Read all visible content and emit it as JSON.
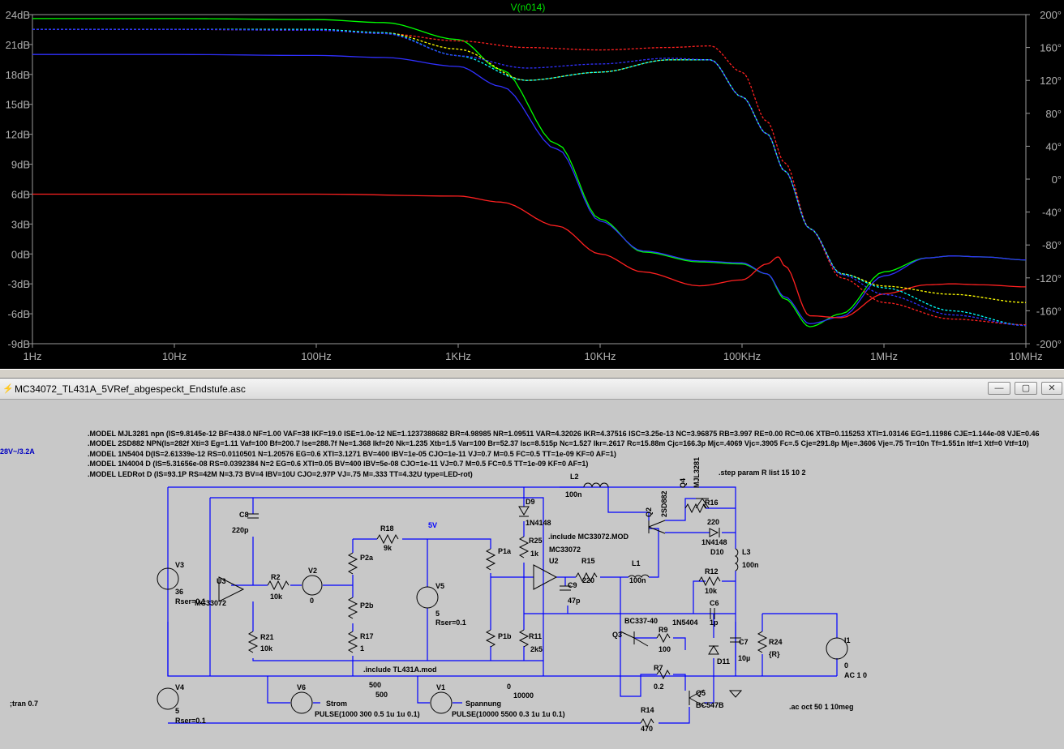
{
  "plot": {
    "trace_label": "V(n014)",
    "x_ticks": [
      "1Hz",
      "10Hz",
      "100Hz",
      "1KHz",
      "10KHz",
      "100KHz",
      "1MHz",
      "10MHz"
    ],
    "y_left_ticks": [
      "24dB",
      "21dB",
      "18dB",
      "15dB",
      "12dB",
      "9dB",
      "6dB",
      "3dB",
      "0dB",
      "-3dB",
      "-6dB",
      "-9dB"
    ],
    "y_right_ticks": [
      "200°",
      "160°",
      "120°",
      "80°",
      "40°",
      "0°",
      "-40°",
      "-80°",
      "-120°",
      "-160°",
      "-200°"
    ],
    "colors": {
      "background": "#000000",
      "grid": "#3a3a3a",
      "axis": "#9a9a9a",
      "label": "#b0b0b0",
      "title": "#00e000"
    }
  },
  "chart_data": {
    "type": "line",
    "title": "V(n014)",
    "x_scale": "log",
    "xlim": [
      1,
      10000000
    ],
    "ylim_left": [
      -9,
      24
    ],
    "ylim_right": [
      -200,
      200
    ],
    "grid": false,
    "series": [
      {
        "color": "#00ff00",
        "axis": "left",
        "style": "solid",
        "x": [
          1,
          10,
          100,
          300,
          1000,
          2000,
          5000,
          10000,
          20000,
          50000,
          100000,
          150000,
          200000,
          300000,
          500000,
          1000000,
          2000000,
          3000000,
          5000000,
          10000000
        ],
        "y": [
          23.6,
          23.6,
          23.5,
          23.2,
          21.5,
          18.5,
          11.0,
          3.5,
          0.2,
          -0.8,
          -1.0,
          -2.0,
          -4.5,
          -7.3,
          -6.0,
          -1.8,
          -0.4,
          -0.2,
          -0.3,
          -0.6
        ]
      },
      {
        "color": "#3030ff",
        "axis": "left",
        "style": "solid",
        "x": [
          1,
          10,
          100,
          300,
          1000,
          2000,
          5000,
          10000,
          20000,
          50000,
          100000,
          150000,
          200000,
          300000,
          500000,
          1000000,
          2000000,
          3000000,
          5000000,
          10000000
        ],
        "y": [
          20.0,
          20.0,
          19.9,
          19.7,
          18.8,
          16.8,
          10.5,
          3.3,
          0.3,
          -0.7,
          -0.9,
          -2.0,
          -4.3,
          -7.0,
          -6.3,
          -2.2,
          -0.4,
          -0.2,
          -0.3,
          -0.6
        ]
      },
      {
        "color": "#ff2020",
        "axis": "left",
        "style": "solid",
        "x": [
          1,
          10,
          100,
          1000,
          2000,
          5000,
          10000,
          20000,
          50000,
          100000,
          150000,
          180000,
          200000,
          300000,
          500000,
          1000000,
          2000000,
          3000000,
          5000000,
          10000000
        ],
        "y": [
          6.0,
          6.0,
          6.0,
          5.8,
          5.2,
          2.8,
          0.0,
          -1.8,
          -3.2,
          -2.6,
          -1.0,
          -0.3,
          -1.2,
          -6.2,
          -6.4,
          -4.0,
          -3.1,
          -3.0,
          -3.1,
          -3.3
        ]
      },
      {
        "color": "#ff2020",
        "axis": "right",
        "style": "dashed",
        "x": [
          1,
          10,
          100,
          300,
          1000,
          3000,
          10000,
          30000,
          60000,
          100000,
          150000,
          200000,
          300000,
          500000,
          1000000,
          3000000,
          10000000
        ],
        "y": [
          182,
          182,
          181,
          177,
          168,
          160,
          157,
          160,
          162,
          130,
          70,
          20,
          -60,
          -120,
          -150,
          -170,
          -177
        ]
      },
      {
        "color": "#ffff00",
        "axis": "right",
        "style": "dashed",
        "x": [
          1,
          10,
          100,
          300,
          1000,
          3000,
          10000,
          30000,
          60000,
          100000,
          150000,
          200000,
          300000,
          500000,
          1000000,
          3000000,
          10000000
        ],
        "y": [
          182,
          182,
          182,
          178,
          158,
          120,
          130,
          145,
          145,
          100,
          55,
          10,
          -60,
          -115,
          -130,
          -140,
          -150
        ]
      },
      {
        "color": "#00ffff",
        "axis": "right",
        "style": "dashed",
        "x": [
          1,
          10,
          100,
          300,
          1000,
          3000,
          10000,
          30000,
          60000,
          100000,
          150000,
          200000,
          300000,
          500000,
          1000000,
          3000000,
          10000000
        ],
        "y": [
          182,
          182,
          182,
          178,
          150,
          120,
          130,
          145,
          145,
          100,
          55,
          10,
          -60,
          -115,
          -132,
          -160,
          -178
        ]
      },
      {
        "color": "#3030ff",
        "axis": "right",
        "style": "dashed",
        "x": [
          1,
          10,
          100,
          300,
          1000,
          3000,
          10000,
          30000,
          60000,
          100000,
          150000,
          200000,
          300000,
          500000,
          1000000,
          3000000,
          10000000
        ],
        "y": [
          182,
          182,
          181,
          177,
          150,
          135,
          140,
          147,
          145,
          100,
          55,
          10,
          -60,
          -116,
          -140,
          -165,
          -178
        ]
      }
    ]
  },
  "schematic": {
    "window_title": "MC34072_TL431A_5VRef_abgespeckt_Endstufe.asc",
    "buttons": {
      "minimize": "—",
      "restore": "▢",
      "close": "✕"
    },
    "models": [
      ".MODEL MJL3281 npn (IS=9.8145e-12 BF=438.0 NF=1.00 VAF=38 IKF=19.0 ISE=1.0e-12 NE=1.1237388682 BR=4.98985 NR=1.09511 VAR=4.32026 IKR=4.37516 ISC=3.25e-13 NC=3.96875 RB=3.997 RE=0.00 RC=0.06 XTB=0.115253 XTI=1.03146 EG=1.11986 CJE=1.144e-08 VJE=0.46",
      ".MODEL 2SD882 NPN(Is=282f Xti=3 Eg=1.11 Vaf=100 Bf=200.7 Ise=288.7f Ne=1.368 Ikf=20 Nk=1.235 Xtb=1.5 Var=100 Br=52.37 Isc=8.515p Nc=1.527 Ikr=.2617 Rc=15.88m Cjc=166.3p Mjc=.4069 Vjc=.3905 Fc=.5 Cje=291.8p Mje=.3606 Vje=.75 Tr=10n Tf=1.551n Itf=1 Xtf=0 Vtf=10)",
      ".MODEL 1N5404 D(IS=2.61339e-12 RS=0.0110501 N=1.20576 EG=0.6 XTI=3.1271 BV=400 IBV=1e-05 CJO=1e-11 VJ=0.7 M=0.5 FC=0.5 TT=1e-09 KF=0 AF=1)",
      ".MODEL 1N4004 D (IS=5.31656e-08 RS=0.0392384 N=2 EG=0.6 XTI=0.05 BV=400 IBV=5e-08 CJO=1e-11 VJ=0.7 M=0.5 FC=0.5 TT=1e-09 KF=0 AF=1)",
      ".MODEL LEDRot D (IS=93.1P RS=42M N=3.73 BV=4 IBV=10U CJO=2.97P VJ=.75 M=.333 TT=4.32U type=LED-rot)"
    ],
    "left_note": "28V~/3.2A",
    "directives": {
      "step": ".step param R list 15 10 2",
      "include_mc": ".include MC33072.MOD",
      "include_tl": ".include TL431A.mod",
      "tran": ";tran 0.7",
      "ac": ".ac oct 50 1 10meg"
    },
    "labels": {
      "V3": "V3",
      "V3_val": "36",
      "V3_rser": "Rser=0.1",
      "V4": "V4",
      "V4_val": "5",
      "V4_rser": "Rser=0.1",
      "U3": "U3",
      "U3_model": "MC33072",
      "C8": "C8",
      "C8_val": "220p",
      "R2": "R2",
      "R2_val": "10k",
      "V2": "V2",
      "V2_val": "0",
      "R21": "R21",
      "R21_val": "10k",
      "R18": "R18",
      "R18_val": "9k",
      "net_5V": "5V",
      "P2a": "P2a",
      "P2b": "P2b",
      "R17": "R17",
      "R17_val": "1",
      "V5": "V5",
      "V5_val": "5",
      "V5_rser": "Rser=0.1",
      "P1a": "P1a",
      "P1b": "P1b",
      "D9": "D9",
      "D9_model": "1N4148",
      "R25": "R25",
      "R25_val": "1k",
      "R11": "R11",
      "R11_val": "2k5",
      "U2": "U2",
      "U2_model": "MC33072",
      "C9": "C9",
      "C9_val": "47p",
      "R15": "R15",
      "R15_val": "220",
      "L1": "L1",
      "L1_val": "100n",
      "L2": "L2",
      "L2_val": "100n",
      "Q2": "Q2",
      "Q2_model": "2SD882",
      "Q4": "Q4",
      "Q4_model": "MJL3281",
      "R16": "R16",
      "R16_val": "220",
      "D10": "D10",
      "D10_model": "1N4148",
      "L3": "L3",
      "L3_val": "100n",
      "R12": "R12",
      "R12_val": "10k",
      "C6": "C6",
      "C6_val": "1p",
      "D_1N5404": "1N5404",
      "Q3": "Q3",
      "Q3_model": "BC337-40",
      "R9": "R9",
      "R9_val": "100",
      "R7": "R7",
      "R7_val": "0.2",
      "Q5": "Q5",
      "Q5_model": "BC547B",
      "C7": "C7",
      "C7_val": "10µ",
      "D11": "D11",
      "R24": "R24",
      "R24_val": "{R}",
      "I1": "I1",
      "I1_val": "0",
      "I1_ac": "AC 1 0",
      "R14": "R14",
      "R14_val": "470",
      "V6": "V6",
      "V6_net": "Strom",
      "V6_pulse": "PULSE(1000 300 0.5 1u 1u 0.1)",
      "V1": "V1",
      "V1_net": "Spannung",
      "V1_pulse": "PULSE(10000 5500 0.3 1u 1u 0.1)",
      "n500a": "500",
      "n500b": "500",
      "n0": "0",
      "n10000": "10000"
    }
  }
}
